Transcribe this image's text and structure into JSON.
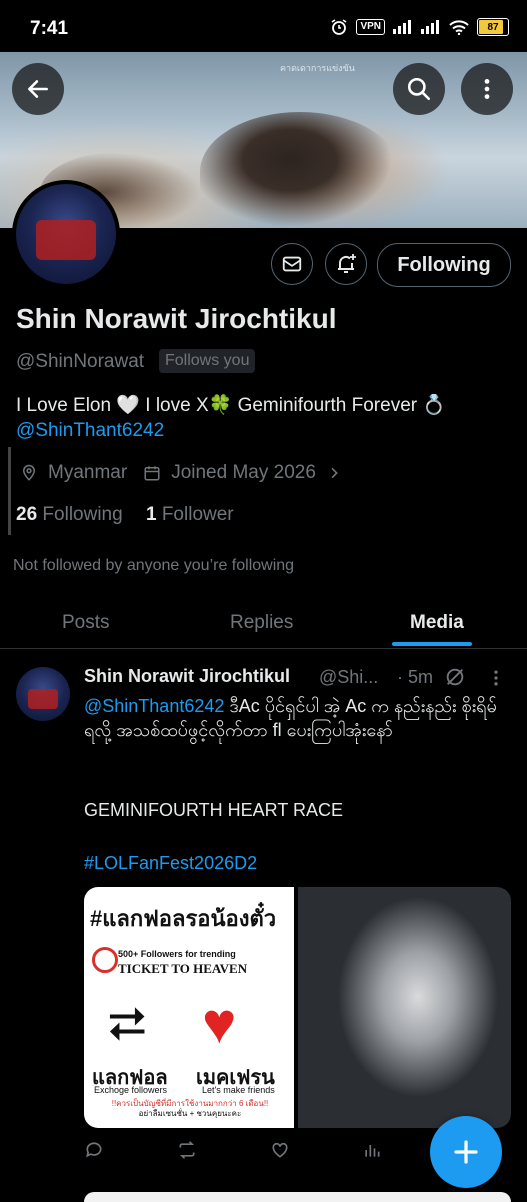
{
  "status_bar": {
    "time": "7:41",
    "vpn": "VPN",
    "battery": "87",
    "icons": [
      "alarm-icon",
      "vpn-badge",
      "signal-icon",
      "signal-icon",
      "wifi-icon",
      "battery-icon"
    ]
  },
  "banner": {
    "overlay_text": "คาดเดาการแข่งขัน"
  },
  "profile": {
    "name": "Shin Norawit Jirochtikul",
    "handle": "@ShinNorawat",
    "follows_you": "Follows you",
    "bio": "I Love Elon 🤍 I love X🍀 Geminifourth Forever 💍",
    "bio_link": "@ShinThant6242",
    "location": "Myanmar",
    "joined": "Joined May 2026",
    "following_count": "26",
    "following_label": "Following",
    "followers_count": "1",
    "followers_label": "Follower",
    "not_followed_text": "Not followed by anyone you’re following",
    "following_button": "Following"
  },
  "tabs": [
    {
      "label": "Posts",
      "active": false
    },
    {
      "label": "Replies",
      "active": false
    },
    {
      "label": "Media",
      "active": true
    }
  ],
  "post": {
    "author": "Shin Norawit Jirochtikul",
    "handle": "@Shi...",
    "time": "· 5m",
    "mention": "@ShinThant6242",
    "text": " ဒီAc ပိုင်ရှင်ပါ အဲ့ Ac က နည်းနည်း စိုးရိမ်ရလို့ အသစ်ထပ်ဖွင့်လိုက်တာ fl ပေးကြပါအုံးနော်",
    "line2": "GEMINIFOURTH HEART RACE",
    "hashtag": "#LOLFanFest2026D2",
    "media_left": {
      "title": "#แลกฟอลรอน้องตั๋ว",
      "sub": "500+ Followers for trending",
      "ticket": "TICKET TO HEAVEN",
      "left_big": "แลกฟอล",
      "left_small": "Exchoge followers",
      "right_big": "เมคเฟรน",
      "right_small": "Let's make friends",
      "foot_line1": "!!ควรเป็นบัญชีที่มีการใช้งานมากกว่า 6 เดือน!!",
      "foot_line2": "อย่าลืมเซนชั่น + ชวนคุยนะคะ"
    }
  },
  "fab_label": "+"
}
